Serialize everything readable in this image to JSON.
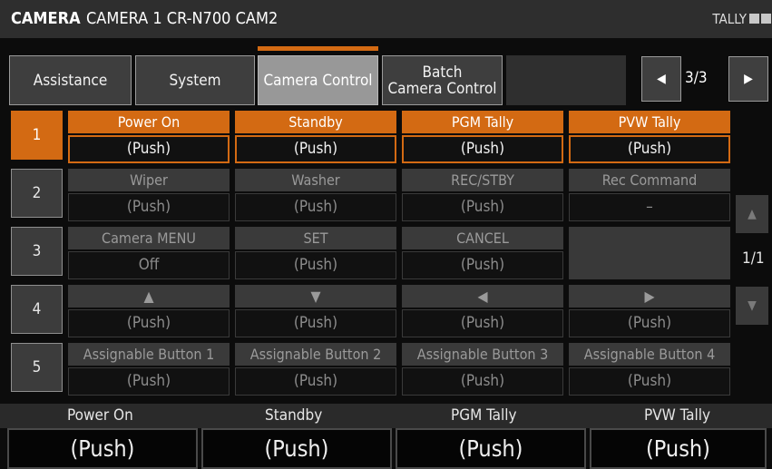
{
  "header": {
    "app_label": "CAMERA",
    "camera_name": "CAMERA 1  CR-N700 CAM2",
    "tally_label": "TALLY"
  },
  "tabs": [
    {
      "label": "Assistance",
      "active": false
    },
    {
      "label": "System",
      "active": false
    },
    {
      "label": "Camera Control",
      "active": true
    },
    {
      "label": "Batch\nCamera Control",
      "active": false
    }
  ],
  "pager": {
    "prev_icon": "left-arrow-icon",
    "next_icon": "right-arrow-icon",
    "text": "3/3"
  },
  "rows": [
    {
      "number": "1",
      "active": true,
      "cells": [
        {
          "label": "Power On",
          "value": "(Push)"
        },
        {
          "label": "Standby",
          "value": "(Push)"
        },
        {
          "label": "PGM Tally",
          "value": "(Push)"
        },
        {
          "label": "PVW Tally",
          "value": "(Push)"
        }
      ]
    },
    {
      "number": "2",
      "active": false,
      "cells": [
        {
          "label": "Wiper",
          "value": "(Push)"
        },
        {
          "label": "Washer",
          "value": "(Push)"
        },
        {
          "label": "REC/STBY",
          "value": "(Push)"
        },
        {
          "label": "Rec Command",
          "value": "–"
        }
      ]
    },
    {
      "number": "3",
      "active": false,
      "cells": [
        {
          "label": "Camera MENU",
          "value": "Off"
        },
        {
          "label": "SET",
          "value": "(Push)"
        },
        {
          "label": "CANCEL",
          "value": "(Push)"
        },
        null
      ]
    },
    {
      "number": "4",
      "active": false,
      "cells": [
        {
          "label": "▲",
          "value": "(Push)"
        },
        {
          "label": "▼",
          "value": "(Push)"
        },
        {
          "label": "◀",
          "value": "(Push)"
        },
        {
          "label": "▶",
          "value": "(Push)"
        }
      ]
    },
    {
      "number": "5",
      "active": false,
      "cells": [
        {
          "label": "Assignable Button 1",
          "value": "(Push)"
        },
        {
          "label": "Assignable Button 2",
          "value": "(Push)"
        },
        {
          "label": "Assignable Button 3",
          "value": "(Push)"
        },
        {
          "label": "Assignable Button 4",
          "value": "(Push)"
        }
      ]
    }
  ],
  "side_pager": {
    "up_icon": "up-arrow-icon",
    "down_icon": "down-arrow-icon",
    "text": "1/1"
  },
  "bottom": [
    {
      "label": "Power On",
      "value": "(Push)"
    },
    {
      "label": "Standby",
      "value": "(Push)"
    },
    {
      "label": "PGM Tally",
      "value": "(Push)"
    },
    {
      "label": "PVW Tally",
      "value": "(Push)"
    }
  ],
  "colors": {
    "accent": "#d36a13",
    "background": "#0c0c0c",
    "panel": "#3a3a3a"
  }
}
